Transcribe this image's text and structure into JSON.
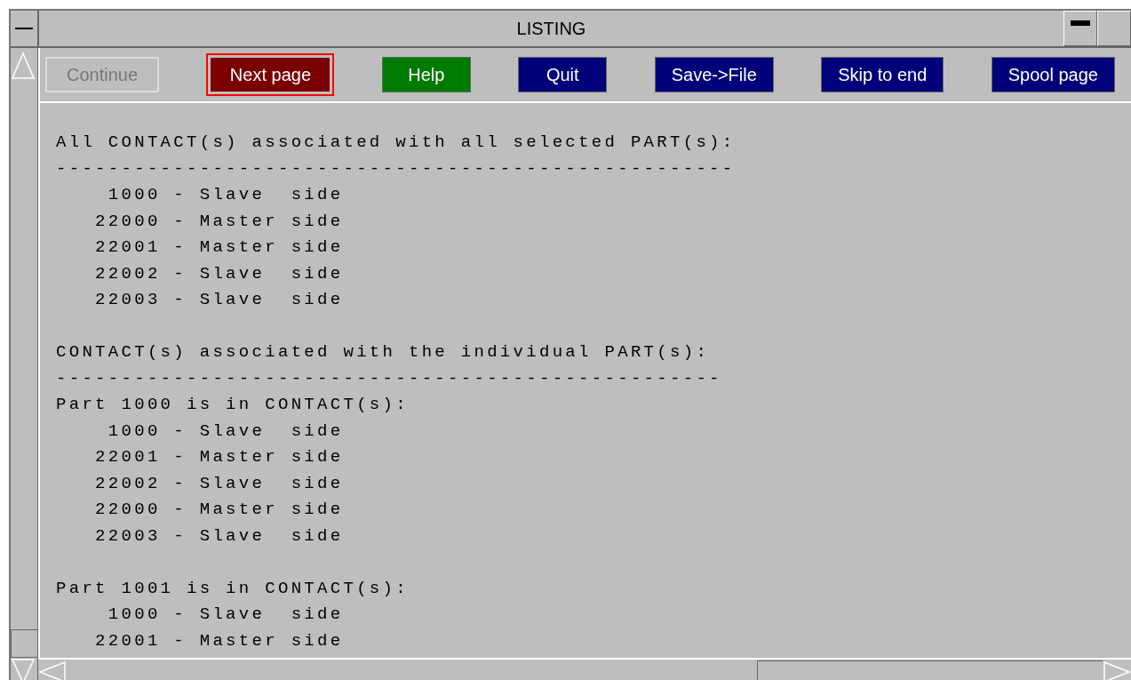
{
  "window": {
    "title": "LISTING"
  },
  "buttons": [
    {
      "label": "Continue",
      "kind": "disabled"
    },
    {
      "label": "Next page",
      "kind": "current"
    },
    {
      "label": "Help",
      "kind": "help"
    },
    {
      "label": "Quit",
      "kind": "action"
    },
    {
      "label": "Save->File",
      "kind": "action"
    },
    {
      "label": "Skip to end",
      "kind": "action"
    },
    {
      "label": "Spool page",
      "kind": "action"
    }
  ],
  "listing": [
    [
      "All CONTACT(s) associated with all selected PART(s):",
      "----------------------------------------------------",
      "    1000 - Slave  side",
      "   22000 - Master side",
      "   22001 - Master side",
      "   22002 - Slave  side",
      "   22003 - Slave  side"
    ],
    [
      "CONTACT(s) associated with the individual PART(s):",
      "---------------------------------------------------",
      "Part 1000 is in CONTACT(s):",
      "    1000 - Slave  side",
      "   22001 - Master side",
      "   22002 - Slave  side",
      "   22000 - Master side",
      "   22003 - Slave  side"
    ],
    [
      "Part 1001 is in CONTACT(s):",
      "    1000 - Slave  side",
      "   22001 - Master side"
    ]
  ]
}
